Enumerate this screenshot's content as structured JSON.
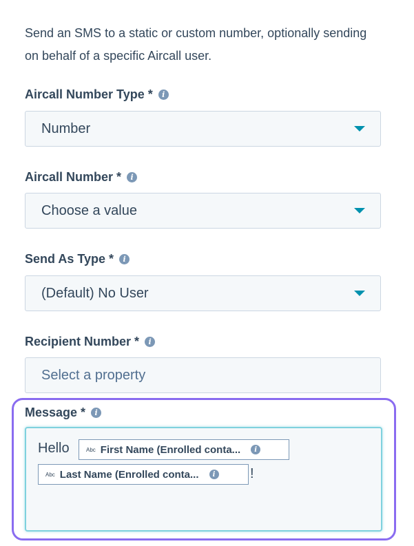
{
  "intro": "Send an SMS to a static or custom number, optionally sending on behalf of a specific Aircall user.",
  "fields": {
    "number_type": {
      "label": "Aircall Number Type *",
      "value": "Number"
    },
    "number": {
      "label": "Aircall Number *",
      "value": "Choose a value"
    },
    "send_as_type": {
      "label": "Send As Type *",
      "value": "(Default) No User"
    },
    "recipient": {
      "label": "Recipient Number *",
      "value": "Select a property"
    },
    "message": {
      "label": "Message *",
      "text_before": "Hello",
      "token_1": {
        "type": "Abc",
        "label": "First Name (Enrolled conta..."
      },
      "token_2": {
        "type": "Abc",
        "label": "Last Name (Enrolled conta..."
      },
      "text_after": "!"
    }
  },
  "icons": {
    "info": "info-icon",
    "caret": "chevron-down-icon"
  },
  "colors": {
    "accent": "#0091ae",
    "highlight": "#8a6cf0",
    "focus_border": "#7fd1de"
  }
}
